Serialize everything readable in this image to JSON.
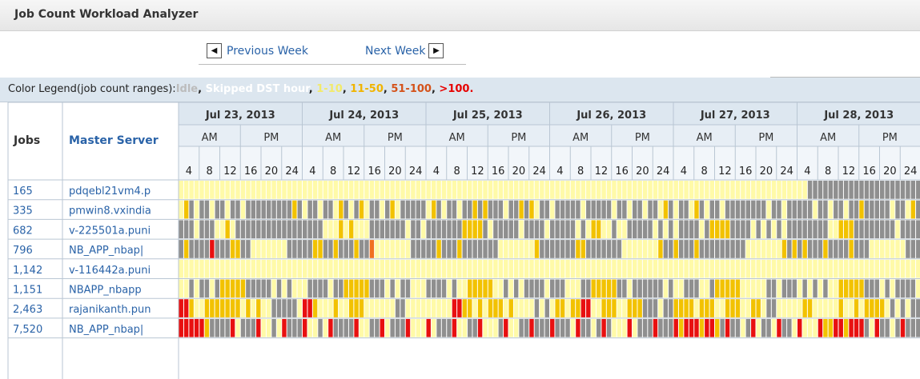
{
  "panel": {
    "title": "Job Count Workload Analyzer"
  },
  "nav": {
    "prev_label": "Previous Week",
    "next_label": "Next Week"
  },
  "legend": {
    "prefix": "Color Legend(job count ranges):",
    "items": [
      {
        "label": "Idle",
        "color": "#bcbcbc"
      },
      {
        "label": "Skipped DST hour",
        "color": "#ffffff"
      },
      {
        "label": "1-10",
        "color": "#f2ea6a"
      },
      {
        "label": "11-50",
        "color": "#f0b400"
      },
      {
        "label": "51-100",
        "color": "#d4521a"
      },
      {
        "label": ">100.",
        "color": "#e60000"
      }
    ]
  },
  "headers": {
    "jobs": "Jobs",
    "master_server": "Master Server",
    "am": "AM",
    "pm": "PM"
  },
  "hour_labels": [
    "4",
    "8",
    "12",
    "16",
    "20",
    "24"
  ],
  "days": [
    "Jul 23, 2013",
    "Jul 24, 2013",
    "Jul 25, 2013",
    "Jul 26, 2013",
    "Jul 27, 2013",
    "Jul 28, 2013"
  ],
  "cell_colors": {
    "idle": "#8f8f8f",
    "low": "#fffaa8",
    "mid": "#f2c200",
    "orange": "#f07020",
    "high": "#e81010"
  },
  "rows": [
    {
      "jobs": "165",
      "server": "pdqebl21vm4.p"
    },
    {
      "jobs": "335",
      "server": "pmwin8.vxindia"
    },
    {
      "jobs": "682",
      "server": "v-225501a.puni"
    },
    {
      "jobs": "796",
      "server": "NB_APP_nbap|"
    },
    {
      "jobs": "1,142",
      "server": "v-116442a.puni"
    },
    {
      "jobs": "1,151",
      "server": "NBAPP_nbapp"
    },
    {
      "jobs": "2,463",
      "server": "rajanikanth.pun"
    },
    {
      "jobs": "7,520",
      "server": "NB_APP_nbap|"
    }
  ]
}
